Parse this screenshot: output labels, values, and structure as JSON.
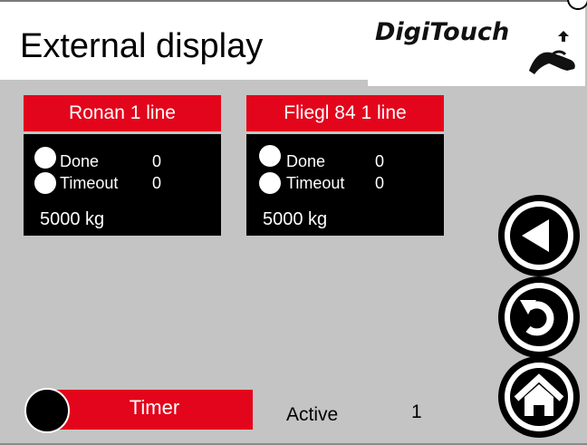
{
  "header": {
    "title": "External display",
    "logo_text": "DigiTouch"
  },
  "cards": [
    {
      "name": "Ronan 1 line",
      "done_label": "Done",
      "done_value": "0",
      "timeout_label": "Timeout",
      "timeout_value": "0",
      "weight": "5000 kg"
    },
    {
      "name": "Fliegl 84 1 line",
      "done_label": "Done",
      "done_value": "0",
      "timeout_label": "Timeout",
      "timeout_value": "0",
      "weight": "5000 kg"
    }
  ],
  "footer": {
    "timer_label": "Timer",
    "active_label": "Active",
    "active_value": "1"
  },
  "nav": {
    "back_icon": "back-triangle-icon",
    "refresh_icon": "refresh-icon",
    "home_icon": "home-icon"
  },
  "colors": {
    "accent_red": "#e3051b",
    "background": "#c4c4c4",
    "panel": "#000000"
  }
}
